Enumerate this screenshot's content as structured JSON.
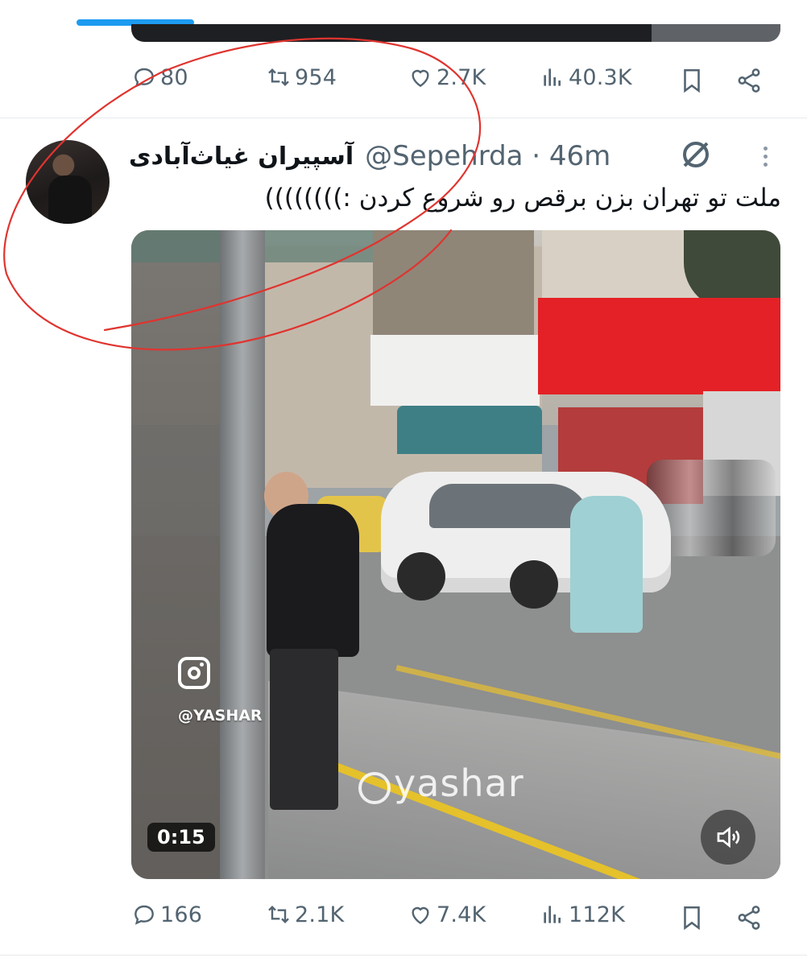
{
  "previous_tweet": {
    "actions": {
      "replies": "80",
      "retweets": "954",
      "likes": "2.7K",
      "views": "40.3K"
    }
  },
  "tweet": {
    "display_name": "آسپیران غیاث‌آبادی",
    "handle": "@Sepehrda · 46m",
    "text": "ملت تو تهران بزن برقص رو شروع کردن :))))))))",
    "media": {
      "overlay_handle": "@YASHAR",
      "watermark_text": "yashar",
      "duration": "0:15"
    },
    "actions": {
      "replies": "166",
      "retweets": "2.1K",
      "likes": "7.4K",
      "views": "112K"
    }
  },
  "colors": {
    "accent": "#1d9bf0",
    "muted_text": "#536471",
    "annotation": "#e0342f",
    "shop_red": "#e32126"
  },
  "icons": [
    "reply-icon",
    "retweet-icon",
    "like-icon",
    "views-icon",
    "bookmark-icon",
    "share-icon",
    "grok-icon",
    "more-icon",
    "instagram-icon",
    "threads-icon",
    "volume-icon"
  ]
}
